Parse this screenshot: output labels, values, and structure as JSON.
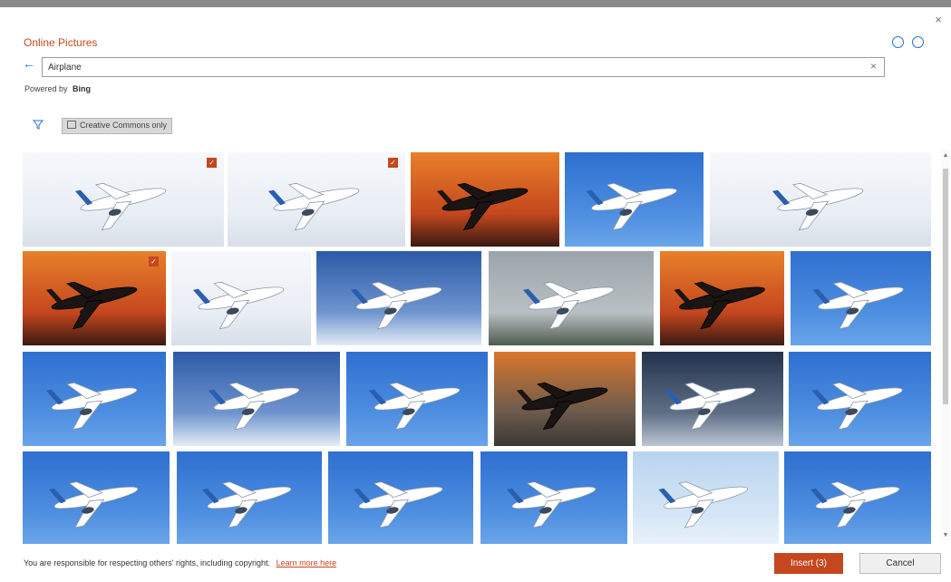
{
  "dialog": {
    "title": "Online Pictures",
    "close_glyph": "×",
    "smile_icon": "smile-icon",
    "frown_icon": "frown-icon"
  },
  "search": {
    "value": "Airplane",
    "clear_glyph": "×",
    "back_glyph": "←"
  },
  "powered": {
    "label": "Powered by",
    "brand": "Bing"
  },
  "filters": {
    "filter_icon": "filter-icon",
    "cc_label": "Creative Commons only"
  },
  "results": [
    {
      "scene": "white-sky",
      "selected": true
    },
    {
      "scene": "white-sky",
      "selected": true
    },
    {
      "scene": "sunset-orange",
      "selected": false
    },
    {
      "scene": "blue-sky",
      "selected": false
    },
    {
      "scene": "white-sky",
      "selected": false
    },
    {
      "scene": "sunset-orange",
      "selected": true
    },
    {
      "scene": "white-sky",
      "selected": false
    },
    {
      "scene": "clouds-blue",
      "selected": false
    },
    {
      "scene": "runway",
      "selected": false
    },
    {
      "scene": "sunset-orange",
      "selected": false
    },
    {
      "scene": "blue-sky",
      "selected": false
    },
    {
      "scene": "blue-sky",
      "selected": false
    },
    {
      "scene": "clouds-blue",
      "selected": false
    },
    {
      "scene": "blue-sky",
      "selected": false
    },
    {
      "scene": "runway-dusk",
      "selected": false
    },
    {
      "scene": "storm-clouds",
      "selected": false
    },
    {
      "scene": "blue-sky",
      "selected": false
    },
    {
      "scene": "blue-sky",
      "selected": false
    },
    {
      "scene": "blue-sky",
      "selected": false
    },
    {
      "scene": "blue-sky",
      "selected": false
    },
    {
      "scene": "blue-sky",
      "selected": false
    },
    {
      "scene": "pale-sky",
      "selected": false
    },
    {
      "scene": "blue-sky",
      "selected": false
    }
  ],
  "footer": {
    "notice": "You are responsible for respecting others' rights, including copyright.",
    "learn_more": "Learn more here",
    "insert_label": "Insert (3)",
    "cancel_label": "Cancel"
  },
  "colors": {
    "accent": "#c4471e",
    "link_blue": "#1f6fd1"
  }
}
